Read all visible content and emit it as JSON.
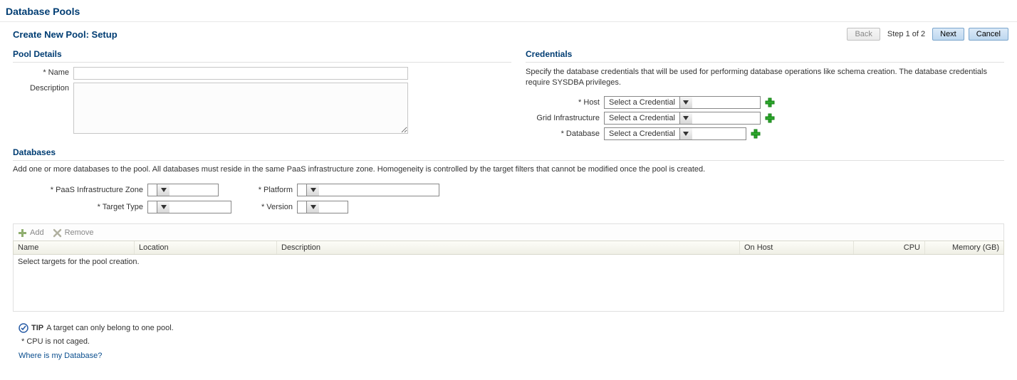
{
  "page": {
    "title": "Database Pools",
    "subtitle": "Create New Pool: Setup",
    "step_indicator": "Step 1 of 2"
  },
  "nav": {
    "back": "Back",
    "next": "Next",
    "cancel": "Cancel"
  },
  "pool_details": {
    "header": "Pool Details",
    "name_label": "Name",
    "name_value": "",
    "description_label": "Description",
    "description_value": ""
  },
  "credentials": {
    "header": "Credentials",
    "description": "Specify the database credentials that will be used for performing database operations like schema creation. The database credentials require SYSDBA privileges.",
    "host_label": "Host",
    "host_value": "Select a Credential",
    "grid_label": "Grid Infrastructure",
    "grid_value": "Select a Credential",
    "database_label": "Database",
    "database_value": "Select a Credential"
  },
  "databases": {
    "header": "Databases",
    "description": "Add one or more databases to the pool. All databases must reside in the same PaaS infrastructure zone. Homogeneity is controlled by the target filters that cannot be modified once the pool is created.",
    "zone_label": "PaaS Infrastructure Zone",
    "zone_value": "",
    "platform_label": "Platform",
    "platform_value": "",
    "target_type_label": "Target Type",
    "target_type_value": "",
    "version_label": "Version",
    "version_value": "",
    "add_label": "Add",
    "remove_label": "Remove",
    "columns": {
      "name": "Name",
      "location": "Location",
      "description": "Description",
      "on_host": "On Host",
      "cpu": "CPU",
      "memory": "Memory (GB)"
    },
    "empty_text": "Select targets for the pool creation."
  },
  "footer": {
    "tip_label": "TIP",
    "tip_text": "A target can only belong to one pool.",
    "cpu_note": "* CPU is not caged.",
    "link": "Where is my Database?"
  }
}
